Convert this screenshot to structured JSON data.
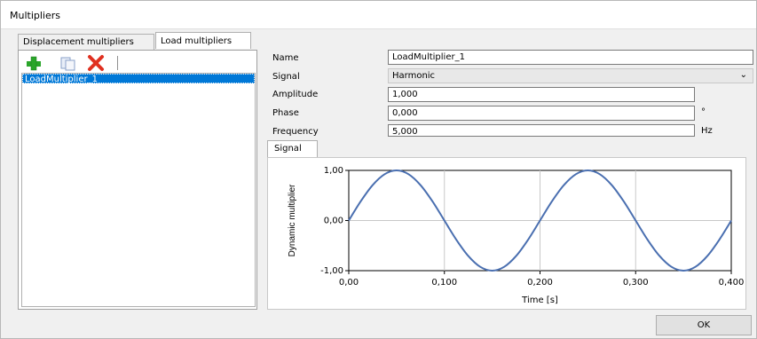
{
  "window": {
    "title": "Multipliers"
  },
  "left": {
    "tabs": [
      {
        "label": "Displacement multipliers"
      },
      {
        "label": "Load multipliers"
      }
    ],
    "toolbar": [
      {
        "icon": "add-icon",
        "color": "#2aa52a"
      },
      {
        "icon": "copy-icon",
        "color": "#8aa0c8"
      },
      {
        "icon": "delete-icon",
        "color": "#e03020"
      }
    ],
    "items": [
      {
        "label": "LoadMultiplier_1",
        "selected": true
      }
    ]
  },
  "form": {
    "name": {
      "label": "Name",
      "value": "LoadMultiplier_1"
    },
    "signal": {
      "label": "Signal",
      "value": "Harmonic"
    },
    "amplitude": {
      "label": "Amplitude",
      "value": "1,000"
    },
    "phase": {
      "label": "Phase",
      "value": "0,000",
      "unit": "°"
    },
    "frequency": {
      "label": "Frequency",
      "value": "5,000",
      "unit": "Hz"
    }
  },
  "chart_tab": {
    "label": "Signal"
  },
  "chart_data": {
    "type": "line",
    "xlabel": "Time [s]",
    "ylabel": "Dynamic multiplier",
    "xlim": [
      0,
      0.4
    ],
    "ylim": [
      -1,
      1
    ],
    "x_tick_values": [
      0,
      0.1,
      0.2,
      0.3,
      0.4
    ],
    "x_ticks": [
      "0,00",
      "0,100",
      "0,200",
      "0,300",
      "0,400"
    ],
    "y_tick_values": [
      1,
      0,
      -1
    ],
    "y_ticks": [
      "1,00",
      "0,00",
      "-1,00"
    ],
    "grid": true,
    "series": [
      {
        "color": "#4a6fb0",
        "x": [
          0,
          0.0125,
          0.025,
          0.0375,
          0.05,
          0.0625,
          0.075,
          0.0875,
          0.1,
          0.1125,
          0.125,
          0.1375,
          0.15,
          0.1625,
          0.175,
          0.1875,
          0.2,
          0.2125,
          0.225,
          0.2375,
          0.25,
          0.2625,
          0.275,
          0.2875,
          0.3,
          0.3125,
          0.325,
          0.3375,
          0.35,
          0.3625,
          0.375,
          0.3875,
          0.4
        ],
        "y": [
          0,
          0.383,
          0.707,
          0.924,
          1,
          0.924,
          0.707,
          0.383,
          0,
          -0.383,
          -0.707,
          -0.924,
          -1,
          -0.924,
          -0.707,
          -0.383,
          0,
          0.383,
          0.707,
          0.924,
          1,
          0.924,
          0.707,
          0.383,
          0,
          -0.383,
          -0.707,
          -0.924,
          -1,
          -0.924,
          -0.707,
          -0.383,
          0
        ]
      }
    ]
  },
  "buttons": {
    "ok": "OK"
  }
}
